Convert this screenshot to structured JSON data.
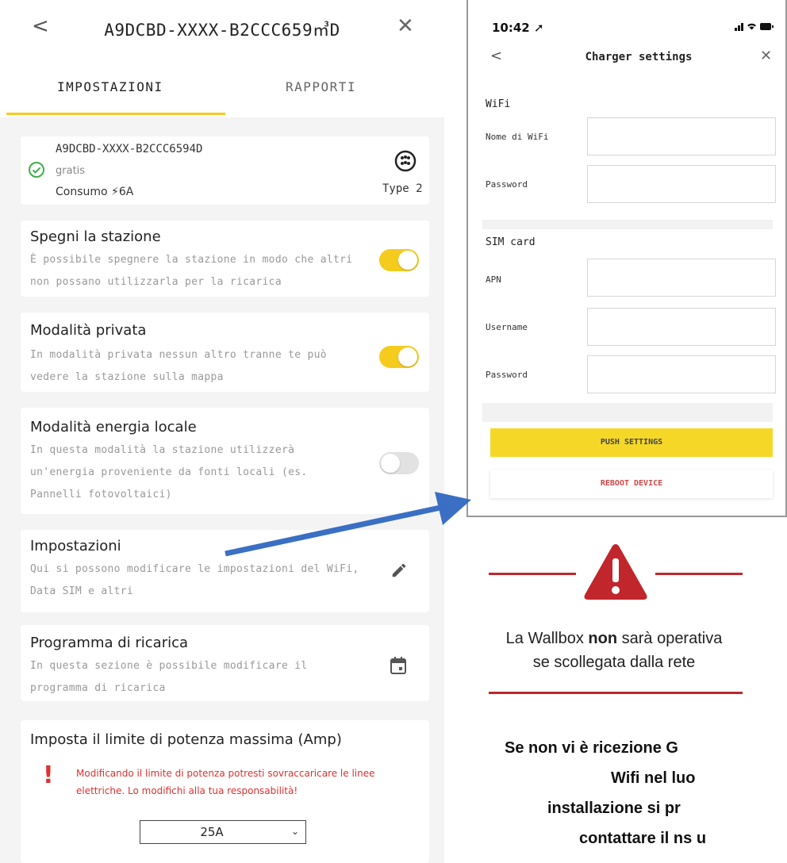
{
  "app": {
    "title": "A9DCBD-XXXX-B2CCC659㎥D",
    "back_icon": "chevron-left-icon",
    "close_icon": "close-icon",
    "tabs": [
      {
        "label": "IMPOSTAZIONI",
        "active": true
      },
      {
        "label": "RAPPORTI",
        "active": false
      }
    ],
    "accent_color": "#f5cc1e"
  },
  "station": {
    "id": "A9DCBD-XXXX-B2CCC6594D",
    "status": "gratis",
    "consumo": "Consumo ⚡6A",
    "connector_type": "Type 2"
  },
  "settings": [
    {
      "title": "Spegni la stazione",
      "desc": "È possibile spegnere la stazione in modo che altri non possano utilizzarla per la ricarica",
      "toggle": "on"
    },
    {
      "title": "Modalità privata",
      "desc": "In modalità privata nessun altro tranne te può vedere la stazione sulla mappa",
      "toggle": "on"
    },
    {
      "title": "Modalità energia locale",
      "desc": "In questa modalità la stazione utilizzerà un'energia proveniente da fonti locali (es. Pannelli fotovoltaici)",
      "toggle": "off"
    },
    {
      "title": "Impostazioni",
      "desc": "Qui si possono modificare le impostazioni del WiFi, Data SIM e altri",
      "icon": "pencil-icon"
    },
    {
      "title": "Programma di ricarica",
      "desc": "In questa sezione è possibile modificare il programma di ricarica",
      "icon": "calendar-icon"
    }
  ],
  "power_limit": {
    "title": "Imposta il limite di potenza massima (Amp)",
    "warning": "Modificando il limite di potenza potresti sovraccaricare le linee elettriche. Lo modifichi alla tua responsabilità!",
    "selected": "25A",
    "warning_color": "#e03030"
  },
  "phone": {
    "time": "10:42",
    "title": "Charger settings",
    "wifi_section": "WiFi",
    "wifi_name_label": "Nome di WiFi",
    "wifi_password_label": "Password",
    "sim_section": "SIM card",
    "apn_label": "APN",
    "username_label": "Username",
    "sim_password_label": "Password",
    "push_button": "PUSH SETTINGS",
    "reboot_button": "REBOOT DEVICE",
    "push_color": "#f5d827",
    "reboot_color": "#d04848"
  },
  "notice": {
    "line1_pre": "La Wallbox ",
    "line1_bold": "non",
    "line1_post": " sarà operativa",
    "line2": "se scollegata dalla rete",
    "icon": "warning-triangle-icon",
    "color": "#c0262c"
  },
  "contact_lines": [
    "Se non vi è ricezione G",
    "Wifi nel luo",
    "installazione si pr",
    "contattare il ns u"
  ]
}
